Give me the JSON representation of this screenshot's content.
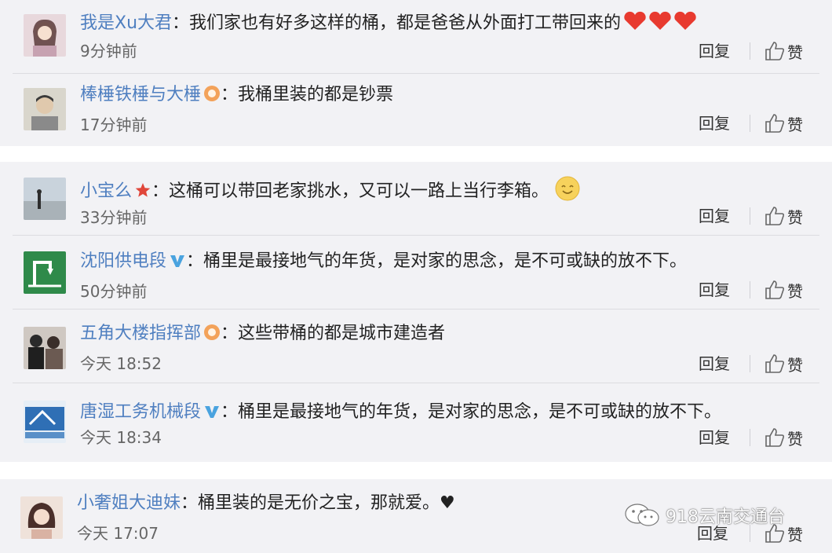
{
  "comments": [
    {
      "username": "我是Xu大君",
      "colon": "：",
      "text": "我们家也有好多这样的桶，都是爸爸从外面打工带回来的",
      "time": "9分钟前",
      "reply": "回复",
      "like": "赞",
      "badge": "none",
      "trailing_icon": "hearts-icon",
      "avatar_icon": "avatar-girl-icon"
    },
    {
      "username": "棒棰铁棰与大棰",
      "colon": "：",
      "text": "我桶里装的都是钞票",
      "time": "17分钟前",
      "reply": "回复",
      "like": "赞",
      "badge": "orange-level-icon",
      "avatar_icon": "avatar-man-icon"
    },
    {
      "username": "小宝么",
      "colon": "：",
      "text": "这桶可以带回老家挑水，又可以一路上当行李箱。",
      "time": "33分钟前",
      "reply": "回复",
      "like": "赞",
      "badge": "red-star-icon",
      "trailing_icon": "smile-emoji-icon",
      "avatar_icon": "avatar-beach-icon"
    },
    {
      "username": "沈阳供电段",
      "colon": "：",
      "text": "桶里是最接地气的年货，是对家的思念，是不可或缺的放不下。",
      "time": "50分钟前",
      "reply": "回复",
      "like": "赞",
      "badge": "verified-v-icon",
      "avatar_icon": "avatar-green-logo-icon"
    },
    {
      "username": "五角大楼指挥部",
      "colon": "：",
      "text": "这些带桶的都是城市建造者",
      "time": "今天 18:52",
      "reply": "回复",
      "like": "赞",
      "badge": "orange-level-icon",
      "avatar_icon": "avatar-people-icon"
    },
    {
      "username": "唐湿工务机械段",
      "colon": "：",
      "text": "桶里是最接地气的年货，是对家的思念，是不可或缺的放不下。",
      "time": "今天 18:34",
      "reply": "回复",
      "like": "赞",
      "badge": "verified-v-icon",
      "avatar_icon": "avatar-blue-logo-icon"
    },
    {
      "username": "小奢姐大迪妹",
      "colon": "：",
      "text": "桶里装的是无价之宝，那就爱。♥",
      "time": "今天 17:07",
      "reply": "回复",
      "like": "赞",
      "badge": "none",
      "avatar_icon": "avatar-woman-icon"
    }
  ],
  "watermark": {
    "text": "918云南交通台",
    "icon": "wechat-icon"
  },
  "colors": {
    "username": "#4f7fc0",
    "panel_bg": "#f2f2f5",
    "page_bg": "#ffffff",
    "verified": "#4aa3df",
    "level_badge": "#f08a24",
    "heart": "#e83a2f"
  }
}
